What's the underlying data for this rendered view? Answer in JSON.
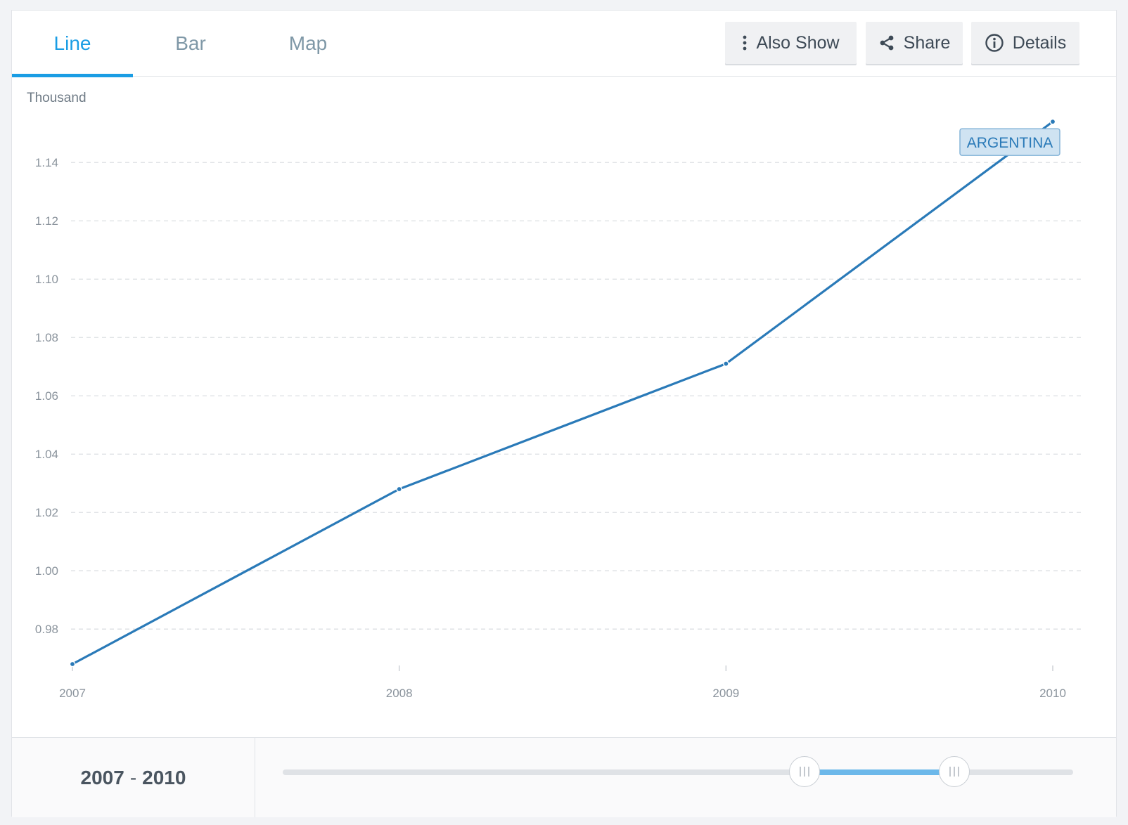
{
  "tabs": [
    {
      "label": "Line",
      "active": true
    },
    {
      "label": "Bar",
      "active": false
    },
    {
      "label": "Map",
      "active": false
    }
  ],
  "toolbar": {
    "also_show": "Also Show",
    "share": "Share",
    "details": "Details"
  },
  "range": {
    "start": "2007",
    "separator": "-",
    "end": "2010",
    "selection_start_fraction": 0.66,
    "selection_end_fraction": 0.85
  },
  "colors": {
    "accent": "#1a9de4",
    "series": "#2a7ab8",
    "label_bg": "#cfe3f2"
  },
  "chart_data": {
    "type": "line",
    "unit_label": "Thousand",
    "x": [
      2007,
      2008,
      2009,
      2010
    ],
    "x_tick_labels": [
      "2007",
      "2008",
      "2009",
      "2010"
    ],
    "y_ticks": [
      0.98,
      1.0,
      1.02,
      1.04,
      1.06,
      1.08,
      1.1,
      1.12,
      1.14
    ],
    "y_tick_labels": [
      "0.98",
      "1.00",
      "1.02",
      "1.04",
      "1.06",
      "1.08",
      "1.10",
      "1.12",
      "1.14"
    ],
    "ylim": [
      0.968,
      1.155
    ],
    "grid": true,
    "series": [
      {
        "name": "ARGENTINA",
        "values": [
          0.968,
          1.028,
          1.071,
          1.154
        ]
      }
    ]
  }
}
